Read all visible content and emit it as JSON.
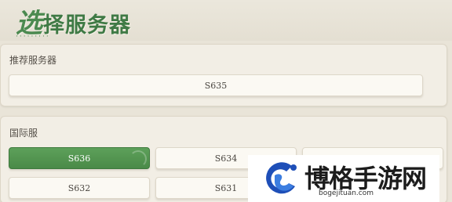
{
  "header": {
    "title_first": "选",
    "title_rest": "择服务器",
    "title_dots": "·········"
  },
  "recommended": {
    "label": "推荐服务器",
    "servers": [
      "S635"
    ]
  },
  "international": {
    "label": "国际服",
    "servers": [
      {
        "name": "S636",
        "selected": true
      },
      {
        "name": "S634",
        "selected": false
      },
      {
        "name": "",
        "selected": false
      },
      {
        "name": "S632",
        "selected": false
      },
      {
        "name": "S631",
        "selected": false
      }
    ]
  },
  "watermark": {
    "text": "博格手游网",
    "url": "bogejituan.com"
  },
  "colors": {
    "accent": "#4a8a48",
    "background": "#e9e4d8",
    "panel": "#f2eee5",
    "logo_blue": "#1e4fb8"
  }
}
